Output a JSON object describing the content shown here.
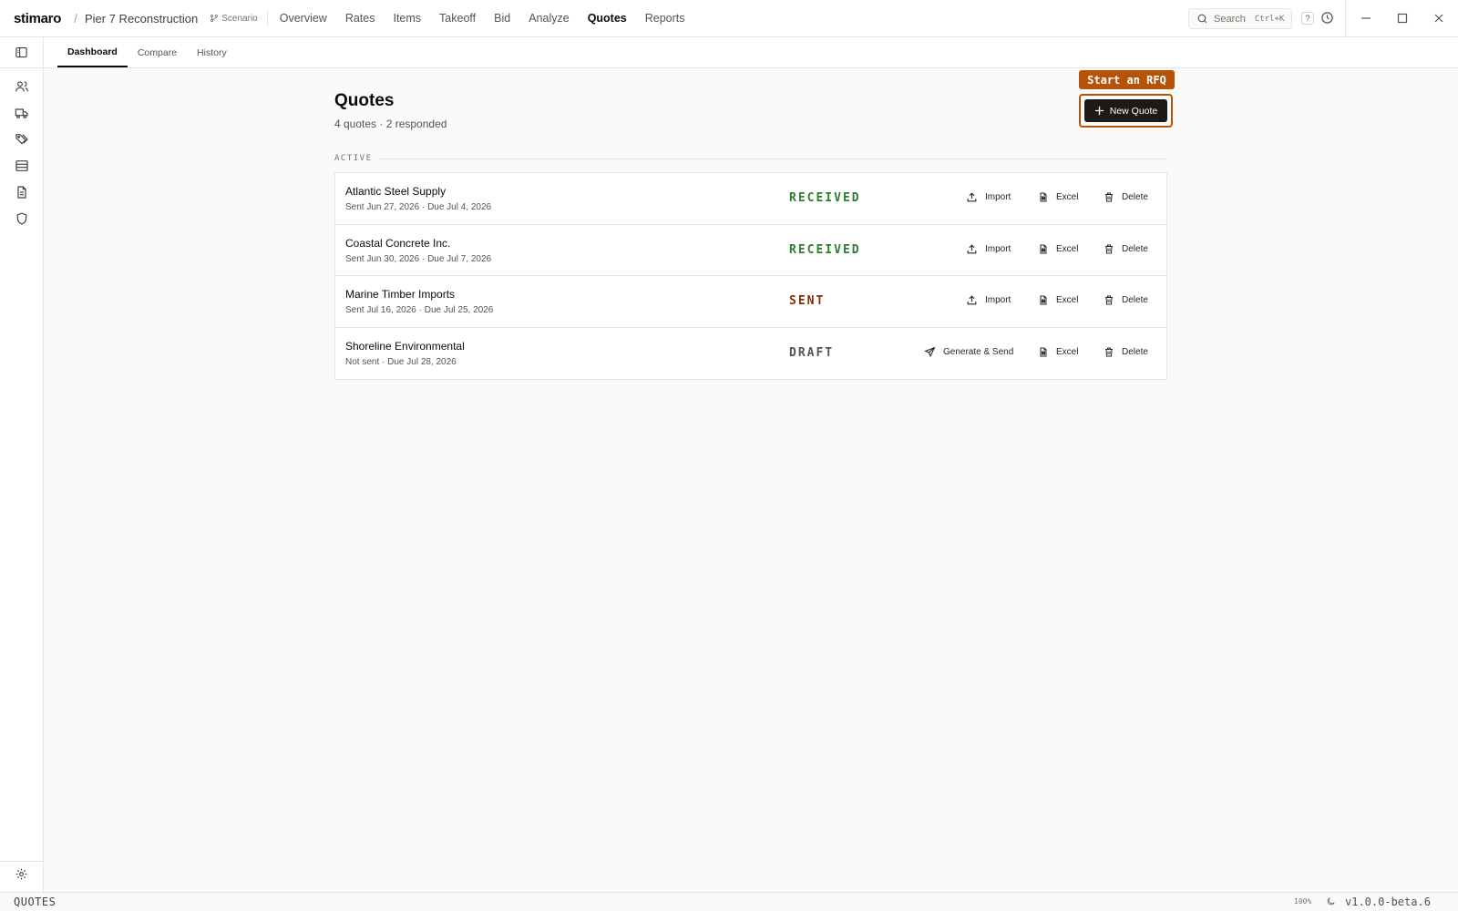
{
  "app": {
    "brand": "stimaro",
    "separator": "/",
    "project": "Pier 7 Reconstruction",
    "scenario_label": "Scenario"
  },
  "nav": [
    {
      "label": "Overview",
      "active": false
    },
    {
      "label": "Rates",
      "active": false
    },
    {
      "label": "Items",
      "active": false
    },
    {
      "label": "Takeoff",
      "active": false
    },
    {
      "label": "Bid",
      "active": false
    },
    {
      "label": "Analyze",
      "active": false
    },
    {
      "label": "Quotes",
      "active": true
    },
    {
      "label": "Reports",
      "active": false
    }
  ],
  "search": {
    "label": "Search",
    "shortcut": "Ctrl+K"
  },
  "help_label": "?",
  "subtabs": [
    {
      "label": "Dashboard",
      "active": true
    },
    {
      "label": "Compare",
      "active": false
    },
    {
      "label": "History",
      "active": false
    }
  ],
  "sidebar_icons": [
    "users-icon",
    "truck-icon",
    "tags-icon",
    "database-icon",
    "file-text-icon",
    "shield-icon",
    "settings-icon"
  ],
  "main": {
    "title": "Quotes",
    "subtitle": "4 quotes · 2 responded",
    "callout": "Start an RFQ",
    "new_quote_label": "New Quote",
    "section_label": "ACTIVE"
  },
  "quotes": [
    {
      "vendor": "Atlantic Steel Supply",
      "meta": "Sent Jun 27, 2026 · Due Jul 4, 2026",
      "status": "RECEIVED",
      "primary_action": "Import",
      "excel": "Excel",
      "delete": "Delete"
    },
    {
      "vendor": "Coastal Concrete Inc.",
      "meta": "Sent Jun 30, 2026 · Due Jul 7, 2026",
      "status": "RECEIVED",
      "primary_action": "Import",
      "excel": "Excel",
      "delete": "Delete"
    },
    {
      "vendor": "Marine Timber Imports",
      "meta": "Sent Jul 16, 2026 · Due Jul 25, 2026",
      "status": "SENT",
      "primary_action": "Import",
      "excel": "Excel",
      "delete": "Delete"
    },
    {
      "vendor": "Shoreline Environmental",
      "meta": "Not sent · Due Jul 28, 2026",
      "status": "DRAFT",
      "primary_action": "Generate & Send",
      "excel": "Excel",
      "delete": "Delete"
    }
  ],
  "statusbar": {
    "mode": "QUOTES",
    "zoom": "100%",
    "version": "v1.0.0-beta.6"
  },
  "colors": {
    "accent": "#b45309",
    "received": "#2e7d32",
    "sent": "#7f2d0e",
    "draft": "#57534e",
    "button_dark": "#1c1917"
  }
}
